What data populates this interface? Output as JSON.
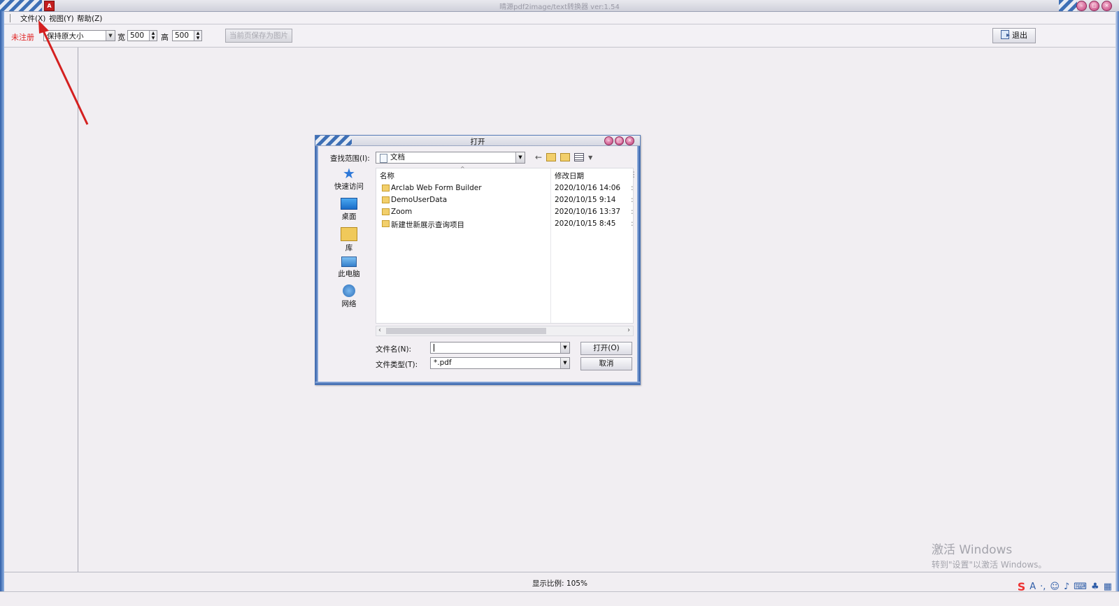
{
  "window": {
    "title": "晴源pdf2image/text转换器 ver:1.54",
    "app_icon": "pdf-app-icon"
  },
  "menu": {
    "items": [
      "文件(X)",
      "视图(Y)",
      "帮助(Z)"
    ]
  },
  "toolbar": {
    "unregistered_label": "未注册",
    "size_mode_selected": "保持原大小",
    "width_label": "宽",
    "width_value": "500",
    "height_label": "高",
    "height_value": "500",
    "save_page_button": "当前页保存为图片",
    "exit_button": "退出"
  },
  "status": {
    "zoom_text": "显示比例: 105%"
  },
  "watermark": {
    "line1": "激活 Windows",
    "line2": "转到\"设置\"以激活 Windows。"
  },
  "dialog": {
    "title": "打开",
    "look_in_label": "查找范围(I):",
    "look_in_value": "文档",
    "places": [
      "快速访问",
      "桌面",
      "库",
      "此电脑",
      "网络"
    ],
    "columns": [
      "名称",
      "修改日期"
    ],
    "files": [
      {
        "name": "Arclab Web Form Builder",
        "date": "2020/10/16 14:06"
      },
      {
        "name": "DemoUserData",
        "date": "2020/10/15 9:14"
      },
      {
        "name": "Zoom",
        "date": "2020/10/16 13:37"
      },
      {
        "name": "新建世新展示查询项目",
        "date": "2020/10/15 8:45"
      }
    ],
    "filename_label": "文件名(N):",
    "filename_value": "",
    "filetype_label": "文件类型(T):",
    "filetype_value": "*.pdf",
    "open_button": "打开(O)",
    "cancel_button": "取消"
  },
  "colors": {
    "accent_blue": "#3d6fb5",
    "unregistered_red": "#e02020",
    "annotation_arrow": "#d42020"
  }
}
